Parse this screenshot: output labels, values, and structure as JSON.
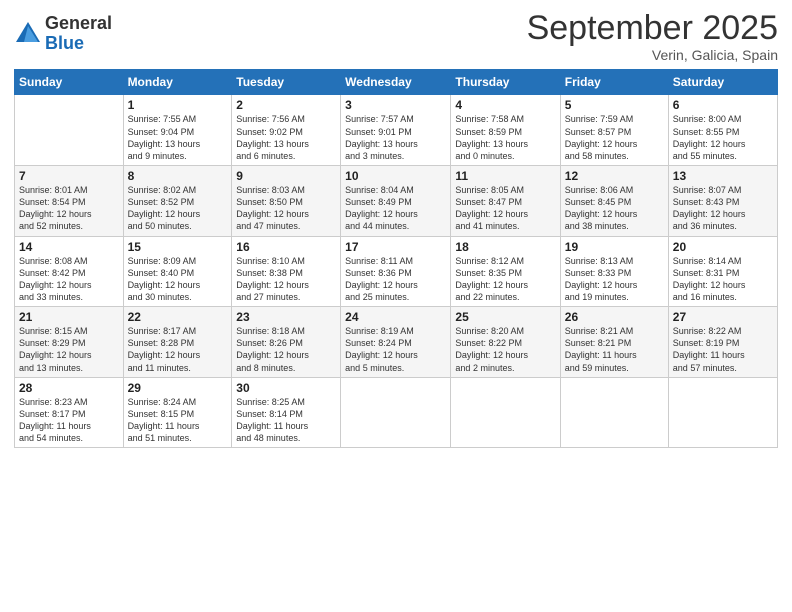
{
  "logo": {
    "general": "General",
    "blue": "Blue"
  },
  "header": {
    "month": "September 2025",
    "location": "Verin, Galicia, Spain"
  },
  "weekdays": [
    "Sunday",
    "Monday",
    "Tuesday",
    "Wednesday",
    "Thursday",
    "Friday",
    "Saturday"
  ],
  "weeks": [
    [
      {
        "day": "",
        "info": ""
      },
      {
        "day": "1",
        "info": "Sunrise: 7:55 AM\nSunset: 9:04 PM\nDaylight: 13 hours\nand 9 minutes."
      },
      {
        "day": "2",
        "info": "Sunrise: 7:56 AM\nSunset: 9:02 PM\nDaylight: 13 hours\nand 6 minutes."
      },
      {
        "day": "3",
        "info": "Sunrise: 7:57 AM\nSunset: 9:01 PM\nDaylight: 13 hours\nand 3 minutes."
      },
      {
        "day": "4",
        "info": "Sunrise: 7:58 AM\nSunset: 8:59 PM\nDaylight: 13 hours\nand 0 minutes."
      },
      {
        "day": "5",
        "info": "Sunrise: 7:59 AM\nSunset: 8:57 PM\nDaylight: 12 hours\nand 58 minutes."
      },
      {
        "day": "6",
        "info": "Sunrise: 8:00 AM\nSunset: 8:55 PM\nDaylight: 12 hours\nand 55 minutes."
      }
    ],
    [
      {
        "day": "7",
        "info": "Sunrise: 8:01 AM\nSunset: 8:54 PM\nDaylight: 12 hours\nand 52 minutes."
      },
      {
        "day": "8",
        "info": "Sunrise: 8:02 AM\nSunset: 8:52 PM\nDaylight: 12 hours\nand 50 minutes."
      },
      {
        "day": "9",
        "info": "Sunrise: 8:03 AM\nSunset: 8:50 PM\nDaylight: 12 hours\nand 47 minutes."
      },
      {
        "day": "10",
        "info": "Sunrise: 8:04 AM\nSunset: 8:49 PM\nDaylight: 12 hours\nand 44 minutes."
      },
      {
        "day": "11",
        "info": "Sunrise: 8:05 AM\nSunset: 8:47 PM\nDaylight: 12 hours\nand 41 minutes."
      },
      {
        "day": "12",
        "info": "Sunrise: 8:06 AM\nSunset: 8:45 PM\nDaylight: 12 hours\nand 38 minutes."
      },
      {
        "day": "13",
        "info": "Sunrise: 8:07 AM\nSunset: 8:43 PM\nDaylight: 12 hours\nand 36 minutes."
      }
    ],
    [
      {
        "day": "14",
        "info": "Sunrise: 8:08 AM\nSunset: 8:42 PM\nDaylight: 12 hours\nand 33 minutes."
      },
      {
        "day": "15",
        "info": "Sunrise: 8:09 AM\nSunset: 8:40 PM\nDaylight: 12 hours\nand 30 minutes."
      },
      {
        "day": "16",
        "info": "Sunrise: 8:10 AM\nSunset: 8:38 PM\nDaylight: 12 hours\nand 27 minutes."
      },
      {
        "day": "17",
        "info": "Sunrise: 8:11 AM\nSunset: 8:36 PM\nDaylight: 12 hours\nand 25 minutes."
      },
      {
        "day": "18",
        "info": "Sunrise: 8:12 AM\nSunset: 8:35 PM\nDaylight: 12 hours\nand 22 minutes."
      },
      {
        "day": "19",
        "info": "Sunrise: 8:13 AM\nSunset: 8:33 PM\nDaylight: 12 hours\nand 19 minutes."
      },
      {
        "day": "20",
        "info": "Sunrise: 8:14 AM\nSunset: 8:31 PM\nDaylight: 12 hours\nand 16 minutes."
      }
    ],
    [
      {
        "day": "21",
        "info": "Sunrise: 8:15 AM\nSunset: 8:29 PM\nDaylight: 12 hours\nand 13 minutes."
      },
      {
        "day": "22",
        "info": "Sunrise: 8:17 AM\nSunset: 8:28 PM\nDaylight: 12 hours\nand 11 minutes."
      },
      {
        "day": "23",
        "info": "Sunrise: 8:18 AM\nSunset: 8:26 PM\nDaylight: 12 hours\nand 8 minutes."
      },
      {
        "day": "24",
        "info": "Sunrise: 8:19 AM\nSunset: 8:24 PM\nDaylight: 12 hours\nand 5 minutes."
      },
      {
        "day": "25",
        "info": "Sunrise: 8:20 AM\nSunset: 8:22 PM\nDaylight: 12 hours\nand 2 minutes."
      },
      {
        "day": "26",
        "info": "Sunrise: 8:21 AM\nSunset: 8:21 PM\nDaylight: 11 hours\nand 59 minutes."
      },
      {
        "day": "27",
        "info": "Sunrise: 8:22 AM\nSunset: 8:19 PM\nDaylight: 11 hours\nand 57 minutes."
      }
    ],
    [
      {
        "day": "28",
        "info": "Sunrise: 8:23 AM\nSunset: 8:17 PM\nDaylight: 11 hours\nand 54 minutes."
      },
      {
        "day": "29",
        "info": "Sunrise: 8:24 AM\nSunset: 8:15 PM\nDaylight: 11 hours\nand 51 minutes."
      },
      {
        "day": "30",
        "info": "Sunrise: 8:25 AM\nSunset: 8:14 PM\nDaylight: 11 hours\nand 48 minutes."
      },
      {
        "day": "",
        "info": ""
      },
      {
        "day": "",
        "info": ""
      },
      {
        "day": "",
        "info": ""
      },
      {
        "day": "",
        "info": ""
      }
    ]
  ]
}
